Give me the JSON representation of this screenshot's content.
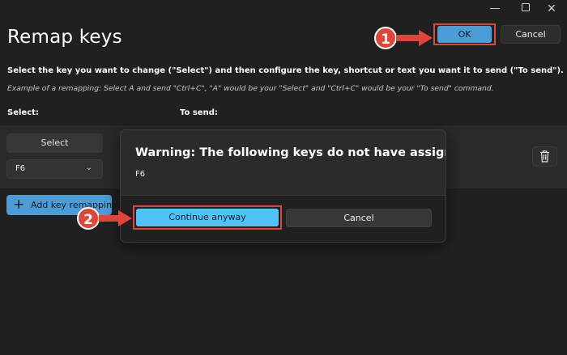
{
  "window": {
    "minimize_icon": "minimize-icon",
    "maximize_icon": "maximize-icon",
    "close_icon": "close-icon",
    "minimize_glyph": "—",
    "close_glyph": "✕"
  },
  "header": {
    "title": "Remap keys",
    "ok_label": "OK",
    "cancel_label": "Cancel"
  },
  "instructions": {
    "main": "Select the key you want to change (\"Select\") and then configure the key, shortcut or text you want it to send (\"To send\").",
    "example": "Example of a remapping: Select A and send \"Ctrl+C\", \"A\" would be your \"Select\" and \"Ctrl+C\" would be your \"To send\" command."
  },
  "columns": {
    "select": "Select:",
    "to_send": "To send:"
  },
  "mapping": {
    "select_button": "Select",
    "key_value": "F6",
    "dropdown_icon": "chevron-down-icon",
    "delete_icon": "trash-icon"
  },
  "add_button": {
    "label": "Add key remapping",
    "icon": "plus-icon"
  },
  "dialog": {
    "title": "Warning: The following keys do not have assignments:",
    "key": "F6",
    "continue_label": "Continue anyway",
    "cancel_label": "Cancel"
  },
  "callouts": [
    {
      "number": "1"
    },
    {
      "number": "2"
    }
  ],
  "colors": {
    "background": "#202020",
    "accent": "#4c9cd6",
    "highlight": "#e0453a"
  }
}
